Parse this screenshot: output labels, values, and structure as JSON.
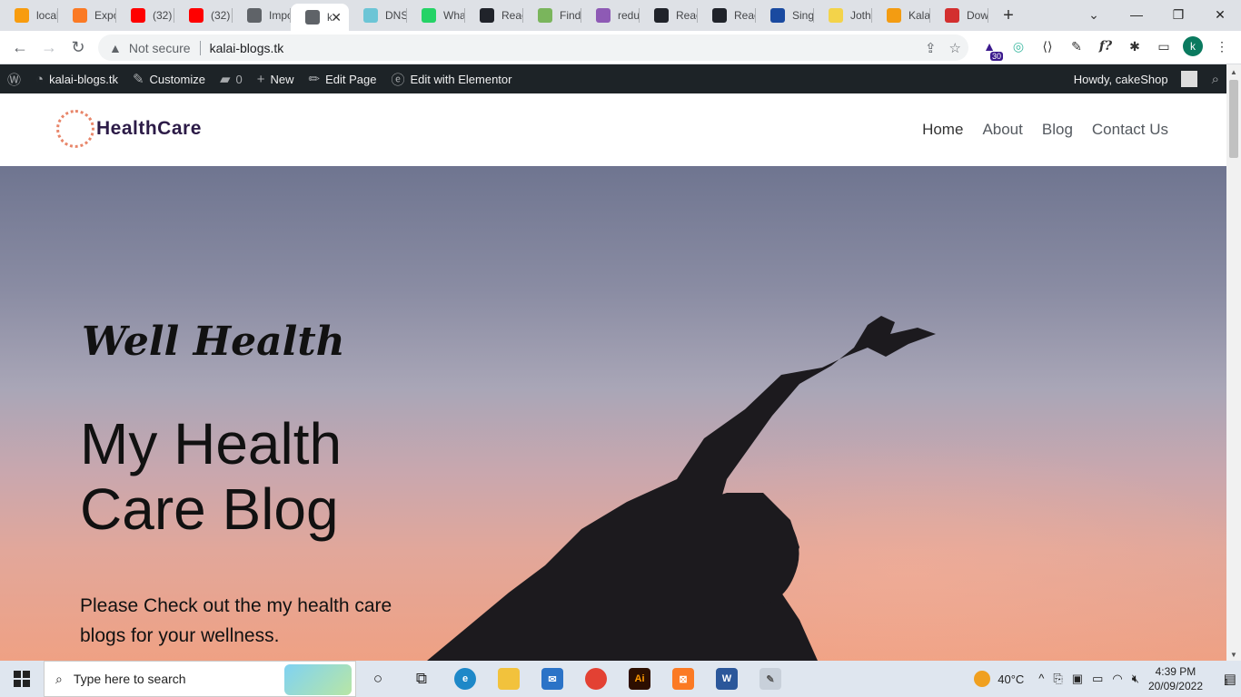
{
  "browser": {
    "tabs": [
      {
        "label": "local",
        "icon": "pma-icon",
        "color": "#f89c0e"
      },
      {
        "label": "Expo",
        "icon": "xampp-icon",
        "color": "#fb7a24"
      },
      {
        "label": "(32)",
        "icon": "youtube-icon",
        "color": "#ff0000"
      },
      {
        "label": "(32)",
        "icon": "youtube-icon",
        "color": "#ff0000"
      },
      {
        "label": "Impo",
        "icon": "globe-icon",
        "color": "#5f6368"
      },
      {
        "label": "k",
        "icon": "globe-icon",
        "color": "#5f6368",
        "active": true
      },
      {
        "label": "DNS",
        "icon": "dns-icon",
        "color": "#6cc5d6"
      },
      {
        "label": "Wha",
        "icon": "whatsapp-icon",
        "color": "#25d366"
      },
      {
        "label": "Reac",
        "icon": "react-icon",
        "color": "#20232a"
      },
      {
        "label": "Find",
        "icon": "find-icon",
        "color": "#7ab55c"
      },
      {
        "label": "redu",
        "icon": "h-icon",
        "color": "#8e5ab5"
      },
      {
        "label": "Reac",
        "icon": "react-icon",
        "color": "#20232a"
      },
      {
        "label": "Reac",
        "icon": "react-icon",
        "color": "#20232a"
      },
      {
        "label": "Sing",
        "icon": "bank-icon",
        "color": "#1a4aa0"
      },
      {
        "label": "Joth",
        "icon": "bookmark-icon",
        "color": "#f3d34a"
      },
      {
        "label": "Kala",
        "icon": "cart-icon",
        "color": "#f39c12"
      },
      {
        "label": "Dow",
        "icon": "heart-icon",
        "color": "#d32f2f"
      }
    ],
    "new_tab": "+",
    "address": {
      "security": "Not secure",
      "url": "kalai-blogs.tk"
    },
    "profile_initial": "k",
    "extension_badge": "30"
  },
  "adminbar": {
    "site": "kalai-blogs.tk",
    "customize": "Customize",
    "comments": "0",
    "new": "New",
    "edit_page": "Edit Page",
    "elementor": "Edit with Elementor",
    "howdy": "Howdy, cakeShop"
  },
  "site": {
    "logo": "HealthCare",
    "nav": [
      "Home",
      "About",
      "Blog",
      "Contact Us"
    ]
  },
  "hero": {
    "tagline": "Well Health",
    "title": "My Health Care Blog",
    "subtitle": "Please Check out the my health care blogs for your wellness."
  },
  "taskbar": {
    "search_placeholder": "Type here to search",
    "weather": "40°C",
    "time": "4:39 PM",
    "date": "20/09/2022",
    "notification_count": "1"
  }
}
